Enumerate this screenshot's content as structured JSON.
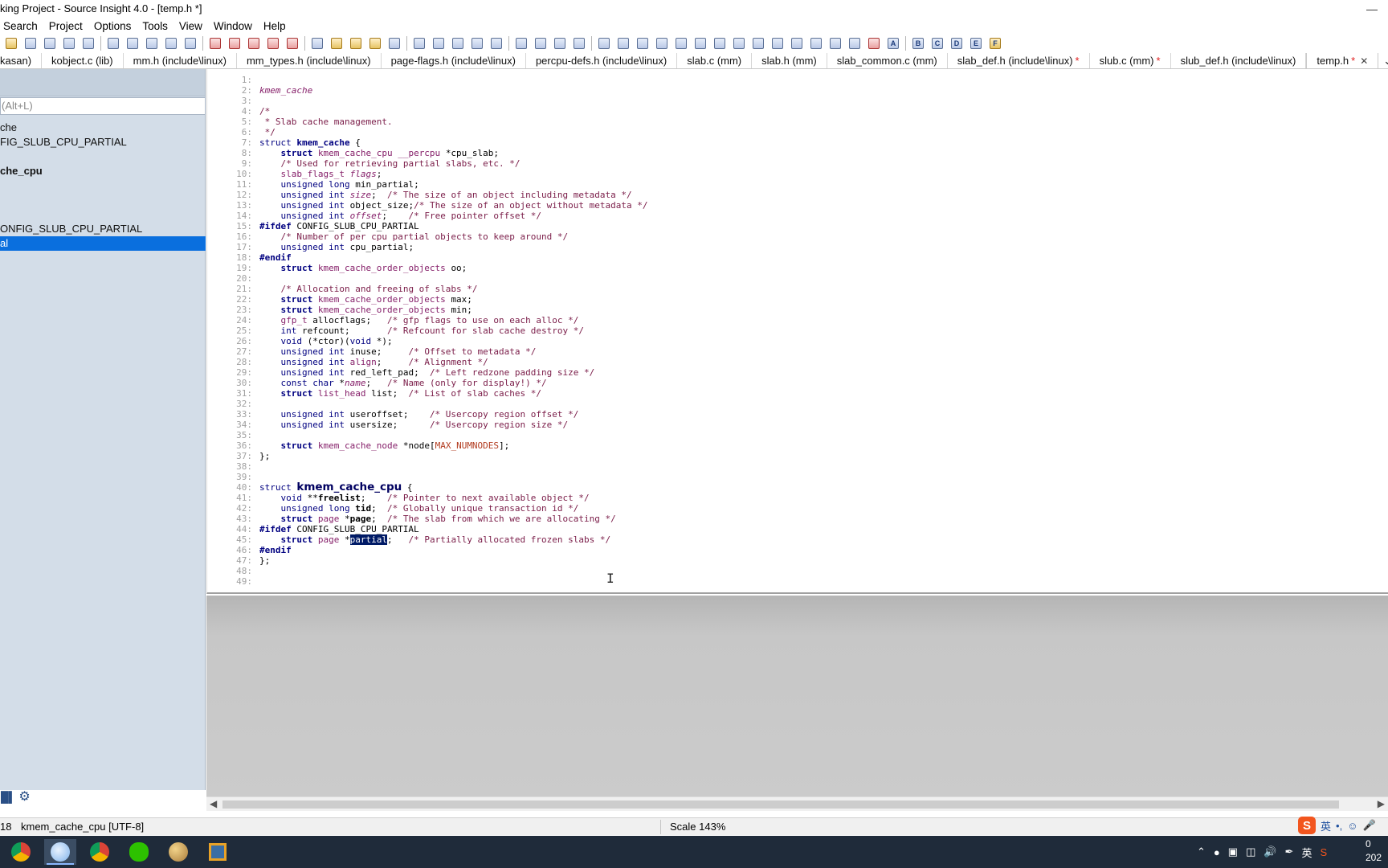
{
  "window": {
    "title": "king Project - Source Insight 4.0 - [temp.h *]",
    "minimize": "—",
    "close": "✕"
  },
  "menu": [
    "Search",
    "Project",
    "Options",
    "Tools",
    "View",
    "Window",
    "Help"
  ],
  "toolbar_icons": [
    "open-file-icon",
    "save-icon",
    "save-all-icon",
    "save-as-icon",
    "print-icon",
    "cut-icon",
    "copy-icon",
    "paste-icon",
    "undo-icon",
    "redo-icon",
    "find-icon",
    "jump-up-icon",
    "jump-down-icon",
    "browse-icon",
    "replace-icon",
    "lookup-icon",
    "bookmark-icon",
    "bookmark-next-icon",
    "bookmark-list-icon",
    "star-icon",
    "project-icon",
    "symbol-window-icon",
    "context-icon",
    "relation-icon",
    "rename-icon",
    "layout-1-icon",
    "layout-2-icon",
    "layout-3-icon",
    "layout-4-icon",
    "p-icon",
    "zoom-icon",
    "tree-icon",
    "s-icon",
    "graph-icon",
    "sync-icon",
    "window-icon",
    "car-icon",
    "bird-icon",
    "link-icon",
    "grid-icon",
    "plus-minus-icon",
    "add-icon",
    "remove-icon",
    "close-x-icon",
    "a-icon",
    "b-icon",
    "c-icon",
    "d-icon",
    "e-icon",
    "f-icon"
  ],
  "tabs": [
    {
      "label": "kasan)",
      "modified": false,
      "active": false
    },
    {
      "label": "kobject.c (lib)",
      "modified": false,
      "active": false
    },
    {
      "label": "mm.h (include\\linux)",
      "modified": false,
      "active": false
    },
    {
      "label": "mm_types.h (include\\linux)",
      "modified": false,
      "active": false
    },
    {
      "label": "page-flags.h (include\\linux)",
      "modified": false,
      "active": false
    },
    {
      "label": "percpu-defs.h (include\\linux)",
      "modified": false,
      "active": false
    },
    {
      "label": "slab.c (mm)",
      "modified": false,
      "active": false
    },
    {
      "label": "slab.h (mm)",
      "modified": false,
      "active": false
    },
    {
      "label": "slab_common.c (mm)",
      "modified": false,
      "active": false
    },
    {
      "label": "slab_def.h (include\\linux)",
      "modified": true,
      "active": false
    },
    {
      "label": "slub.c (mm)",
      "modified": true,
      "active": false
    },
    {
      "label": "slub_def.h (include\\linux)",
      "modified": false,
      "active": false
    },
    {
      "label": "temp.h",
      "modified": true,
      "active": true
    }
  ],
  "tab_modified_mark": "*",
  "tab_close": "✕",
  "tab_overflow": "⌄",
  "symbol_panel": {
    "search_placeholder": "(Alt+L)",
    "items": [
      {
        "label": "che",
        "bold": false,
        "selected": false
      },
      {
        "label": "FIG_SLUB_CPU_PARTIAL",
        "bold": false,
        "selected": false
      },
      {
        "label": "",
        "bold": false,
        "selected": false
      },
      {
        "label": "che_cpu",
        "bold": true,
        "selected": false
      },
      {
        "label": "",
        "bold": false,
        "selected": false
      },
      {
        "label": "",
        "bold": false,
        "selected": false
      },
      {
        "label": "",
        "bold": false,
        "selected": false
      },
      {
        "label": "ONFIG_SLUB_CPU_PARTIAL",
        "bold": false,
        "selected": false
      },
      {
        "label": "al",
        "bold": false,
        "selected": true
      }
    ]
  },
  "code_lines": [
    [],
    [
      [
        "hd",
        "kmem_cache"
      ]
    ],
    [],
    [
      [
        "cm",
        "/*"
      ]
    ],
    [
      [
        "cm",
        " * Slab cache management."
      ]
    ],
    [
      [
        "cm",
        " */"
      ]
    ],
    [
      [
        "kw",
        "struct "
      ],
      [
        "kw bo",
        "kmem_cache"
      ],
      [
        "id",
        " {"
      ]
    ],
    [
      [
        "id",
        "    "
      ],
      [
        "kw bo",
        "struct "
      ],
      [
        "ty",
        "kmem_cache_cpu __percpu "
      ],
      [
        "id",
        "*cpu_slab;"
      ]
    ],
    [
      [
        "id",
        "    "
      ],
      [
        "cm",
        "/* Used for retrieving partial slabs, etc. */"
      ]
    ],
    [
      [
        "id",
        "    "
      ],
      [
        "ty",
        "slab_flags_t "
      ],
      [
        "ty it",
        "flags"
      ],
      [
        "id",
        ";"
      ]
    ],
    [
      [
        "id",
        "    "
      ],
      [
        "kw",
        "unsigned long "
      ],
      [
        "id",
        "min_partial;"
      ]
    ],
    [
      [
        "id",
        "    "
      ],
      [
        "kw",
        "unsigned int "
      ],
      [
        "ty it",
        "size"
      ],
      [
        "id",
        ";  "
      ],
      [
        "cm",
        "/* The size of an object including metadata */"
      ]
    ],
    [
      [
        "id",
        "    "
      ],
      [
        "kw",
        "unsigned int "
      ],
      [
        "id",
        "object_size;"
      ],
      [
        "cm",
        "/* The size of an object without metadata */"
      ]
    ],
    [
      [
        "id",
        "    "
      ],
      [
        "kw",
        "unsigned int "
      ],
      [
        "ty it",
        "offset"
      ],
      [
        "id",
        ";    "
      ],
      [
        "cm",
        "/* Free pointer offset */"
      ]
    ],
    [
      [
        "pp bo",
        "#ifdef "
      ],
      [
        "id",
        "CONFIG_SLUB_CPU_PARTIAL"
      ]
    ],
    [
      [
        "id",
        "    "
      ],
      [
        "cm",
        "/* Number of per cpu partial objects to keep around */"
      ]
    ],
    [
      [
        "id",
        "    "
      ],
      [
        "kw",
        "unsigned int "
      ],
      [
        "id",
        "cpu_partial;"
      ]
    ],
    [
      [
        "pp bo",
        "#endif"
      ]
    ],
    [
      [
        "id",
        "    "
      ],
      [
        "kw bo",
        "struct "
      ],
      [
        "ty",
        "kmem_cache_order_objects "
      ],
      [
        "id",
        "oo;"
      ]
    ],
    [],
    [
      [
        "id",
        "    "
      ],
      [
        "cm",
        "/* Allocation and freeing of slabs */"
      ]
    ],
    [
      [
        "id",
        "    "
      ],
      [
        "kw bo",
        "struct "
      ],
      [
        "ty",
        "kmem_cache_order_objects "
      ],
      [
        "id",
        "max;"
      ]
    ],
    [
      [
        "id",
        "    "
      ],
      [
        "kw bo",
        "struct "
      ],
      [
        "ty",
        "kmem_cache_order_objects "
      ],
      [
        "id",
        "min;"
      ]
    ],
    [
      [
        "id",
        "    "
      ],
      [
        "ty",
        "gfp_t "
      ],
      [
        "id",
        "allocflags;   "
      ],
      [
        "cm",
        "/* gfp flags to use on each alloc */"
      ]
    ],
    [
      [
        "id",
        "    "
      ],
      [
        "kw",
        "int "
      ],
      [
        "id",
        "refcount;       "
      ],
      [
        "cm",
        "/* Refcount for slab cache destroy */"
      ]
    ],
    [
      [
        "id",
        "    "
      ],
      [
        "kw",
        "void "
      ],
      [
        "id",
        "(*ctor)("
      ],
      [
        "kw",
        "void "
      ],
      [
        "id",
        "*);"
      ]
    ],
    [
      [
        "id",
        "    "
      ],
      [
        "kw",
        "unsigned int "
      ],
      [
        "id",
        "inuse;     "
      ],
      [
        "cm",
        "/* Offset to metadata */"
      ]
    ],
    [
      [
        "id",
        "    "
      ],
      [
        "kw",
        "unsigned int "
      ],
      [
        "ty",
        "align"
      ],
      [
        "id",
        ";     "
      ],
      [
        "cm",
        "/* Alignment */"
      ]
    ],
    [
      [
        "id",
        "    "
      ],
      [
        "kw",
        "unsigned int "
      ],
      [
        "id",
        "red_left_pad;  "
      ],
      [
        "cm",
        "/* Left redzone padding size */"
      ]
    ],
    [
      [
        "id",
        "    "
      ],
      [
        "kw",
        "const char "
      ],
      [
        "id",
        "*"
      ],
      [
        "ty it",
        "name"
      ],
      [
        "id",
        ";   "
      ],
      [
        "cm",
        "/* Name (only for display!) */"
      ]
    ],
    [
      [
        "id",
        "    "
      ],
      [
        "kw bo",
        "struct "
      ],
      [
        "ty",
        "list_head "
      ],
      [
        "id",
        "list;  "
      ],
      [
        "cm",
        "/* List of slab caches */"
      ]
    ],
    [],
    [
      [
        "id",
        "    "
      ],
      [
        "kw",
        "unsigned int "
      ],
      [
        "id",
        "useroffset;    "
      ],
      [
        "cm",
        "/* Usercopy region offset */"
      ]
    ],
    [
      [
        "id",
        "    "
      ],
      [
        "kw",
        "unsigned int "
      ],
      [
        "id",
        "usersize;      "
      ],
      [
        "cm",
        "/* Usercopy region size */"
      ]
    ],
    [],
    [
      [
        "id",
        "    "
      ],
      [
        "kw bo",
        "struct "
      ],
      [
        "ty",
        "kmem_cache_node "
      ],
      [
        "id",
        "*node["
      ],
      [
        "mac",
        "MAX_NUMNODES"
      ],
      [
        "id",
        "];"
      ]
    ],
    [
      [
        "id",
        "};"
      ]
    ],
    [],
    [],
    [
      [
        "kw",
        "struct "
      ],
      [
        "bigname",
        "kmem_cache_cpu"
      ],
      [
        "id",
        " {"
      ]
    ],
    [
      [
        "id",
        "    "
      ],
      [
        "kw",
        "void "
      ],
      [
        "id",
        "**"
      ],
      [
        "bo",
        "freelist"
      ],
      [
        "id",
        ";    "
      ],
      [
        "cm",
        "/* Pointer to next available object */"
      ]
    ],
    [
      [
        "id",
        "    "
      ],
      [
        "kw",
        "unsigned long "
      ],
      [
        "bo",
        "tid"
      ],
      [
        "id",
        ";  "
      ],
      [
        "cm",
        "/* Globally unique transaction id */"
      ]
    ],
    [
      [
        "id",
        "    "
      ],
      [
        "kw bo",
        "struct "
      ],
      [
        "ty",
        "page "
      ],
      [
        "id",
        "*"
      ],
      [
        "bo",
        "page"
      ],
      [
        "id",
        ";  "
      ],
      [
        "cm",
        "/* The slab from which we are allocating */"
      ]
    ],
    [
      [
        "pp bo",
        "#ifdef "
      ],
      [
        "id",
        "CONFIG_SLUB_CPU_PARTIAL"
      ]
    ],
    [
      [
        "id",
        "    "
      ],
      [
        "kw bo",
        "struct "
      ],
      [
        "ty",
        "page "
      ],
      [
        "id",
        "*"
      ],
      [
        "selword",
        "partial"
      ],
      [
        "id",
        ";   "
      ],
      [
        "cm",
        "/* Partially allocated frozen slabs */"
      ]
    ],
    [
      [
        "pp bo",
        "#endif"
      ]
    ],
    [
      [
        "id",
        "};"
      ]
    ],
    [],
    []
  ],
  "status": {
    "line": "18",
    "context": "kmem_cache_cpu [UTF-8]",
    "scale": "Scale 143%"
  },
  "ime": {
    "logo": "S",
    "lang": "英",
    "punct": "•,",
    "emoji": "☺"
  },
  "taskbar": {
    "apps": [
      "chrome-icon",
      "source-insight-icon",
      "chrome-alt-icon",
      "wechat-icon",
      "paint-icon",
      "vmware-icon"
    ],
    "tray_lang": "英",
    "clock_top": "0",
    "clock_bottom": "202"
  }
}
